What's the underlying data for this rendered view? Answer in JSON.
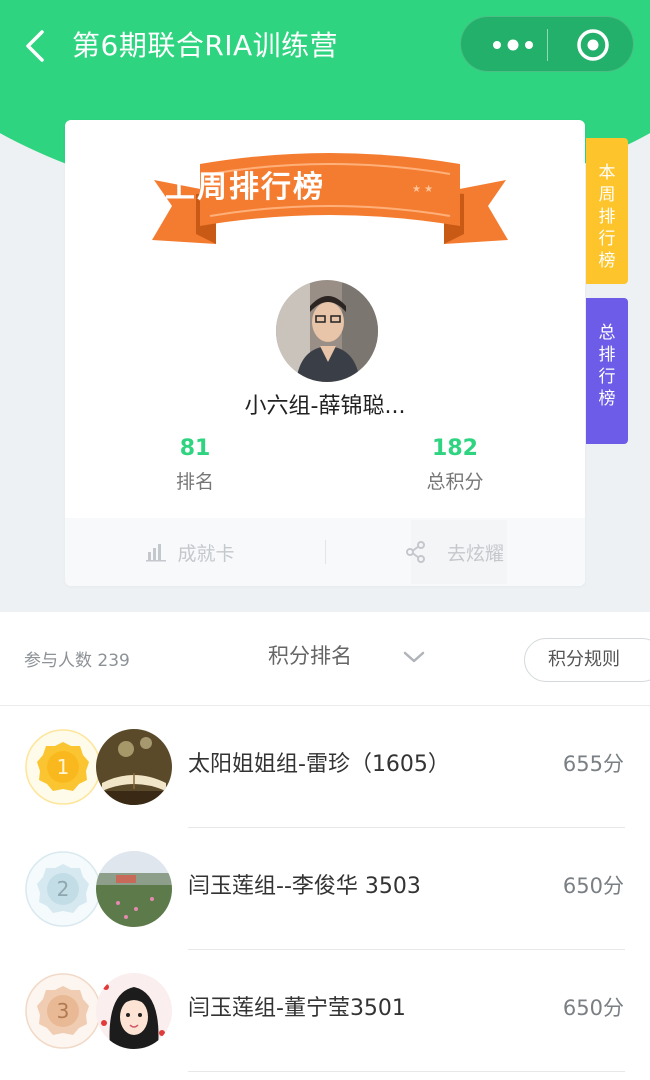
{
  "nav": {
    "title": "第6期联合RIA训练营"
  },
  "card": {
    "ribbon_title": "上周排行榜",
    "user_name": "小六组-薛锦聪...",
    "rank_value": "81",
    "rank_label": "排名",
    "total_value": "182",
    "total_label": "总积分",
    "achievement_label": "成就卡",
    "share_label": "去炫耀"
  },
  "side_tabs": {
    "week": "本周排行榜",
    "total": "总排行榜"
  },
  "list": {
    "participants": "参与人数 239",
    "sort_label": "积分排名",
    "rules_label": "积分规则",
    "rows": [
      {
        "rank": "1",
        "name": "太阳姐姐组-雷珍（1605）",
        "score": "655分"
      },
      {
        "rank": "2",
        "name": "闫玉莲组--李俊华 3503",
        "score": "650分"
      },
      {
        "rank": "3",
        "name": "闫玉莲组-董宁莹3501",
        "score": "650分"
      }
    ]
  },
  "colors": {
    "brand_green": "#2ed47f",
    "ribbon_orange": "#f47c30",
    "tab_yellow": "#fdc52b",
    "tab_purple": "#6c5ce7"
  }
}
